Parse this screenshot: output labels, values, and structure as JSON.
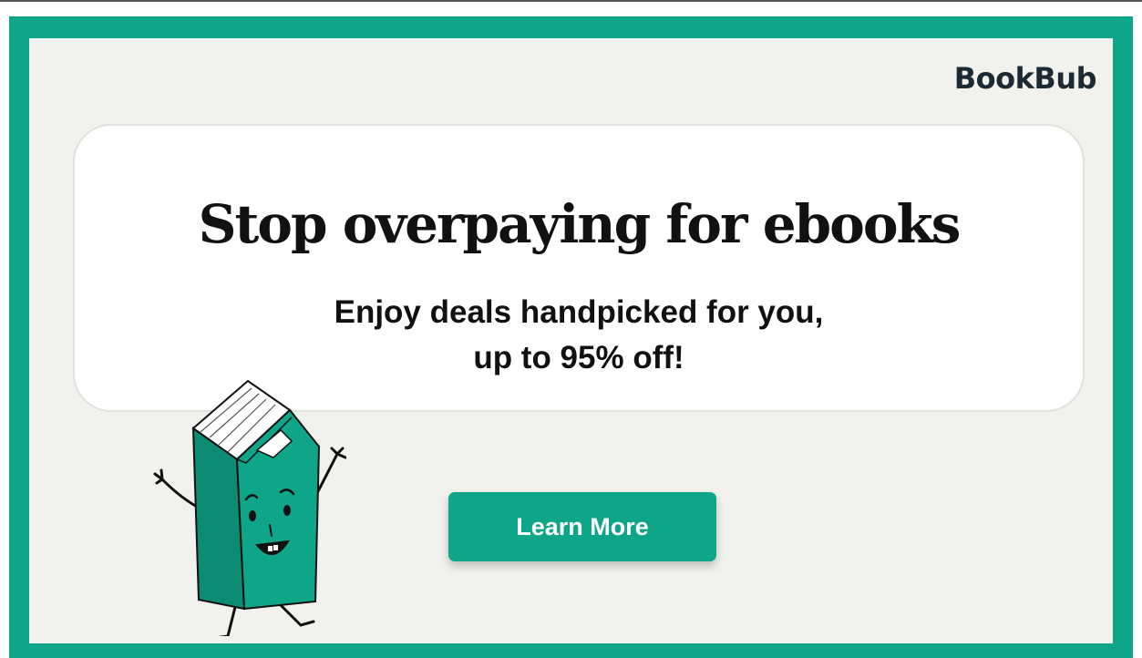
{
  "ad": {
    "brand": "BookBub",
    "headline": "Stop overpaying for ebooks",
    "subline": [
      "Enjoy deals handpicked for you,",
      "up to 95% off!"
    ],
    "cta_label": "Learn More"
  },
  "colors": {
    "frame": "#0ea588",
    "background": "#f1f2ee",
    "card": "#ffffff",
    "text": "#111111",
    "button": "#0ea588",
    "button_text": "#ffffff",
    "logo": "#1c2b33"
  },
  "icons": {
    "mascot": "book-mascot-icon"
  }
}
